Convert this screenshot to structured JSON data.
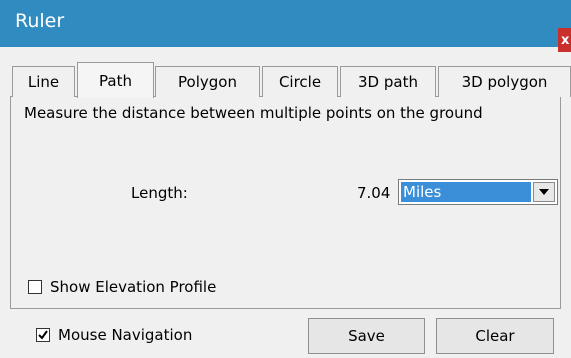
{
  "window": {
    "title": "Ruler",
    "close_label": "x"
  },
  "tabs": [
    {
      "label": "Line",
      "active": false
    },
    {
      "label": "Path",
      "active": true
    },
    {
      "label": "Polygon",
      "active": false
    },
    {
      "label": "Circle",
      "active": false
    },
    {
      "label": "3D path",
      "active": false
    },
    {
      "label": "3D polygon",
      "active": false
    }
  ],
  "panel": {
    "description": "Measure the distance between multiple points on the ground",
    "length_label": "Length:",
    "length_value": "7.04",
    "unit_selected": "Miles",
    "show_elevation_label": "Show Elevation Profile",
    "show_elevation_checked": false
  },
  "footer": {
    "mouse_nav_label": "Mouse Navigation",
    "mouse_nav_checked": true,
    "save_label": "Save",
    "clear_label": "Clear"
  },
  "colors": {
    "titlebar": "#2f8bc0",
    "selection": "#3b8fd8",
    "close": "#c9302c"
  }
}
